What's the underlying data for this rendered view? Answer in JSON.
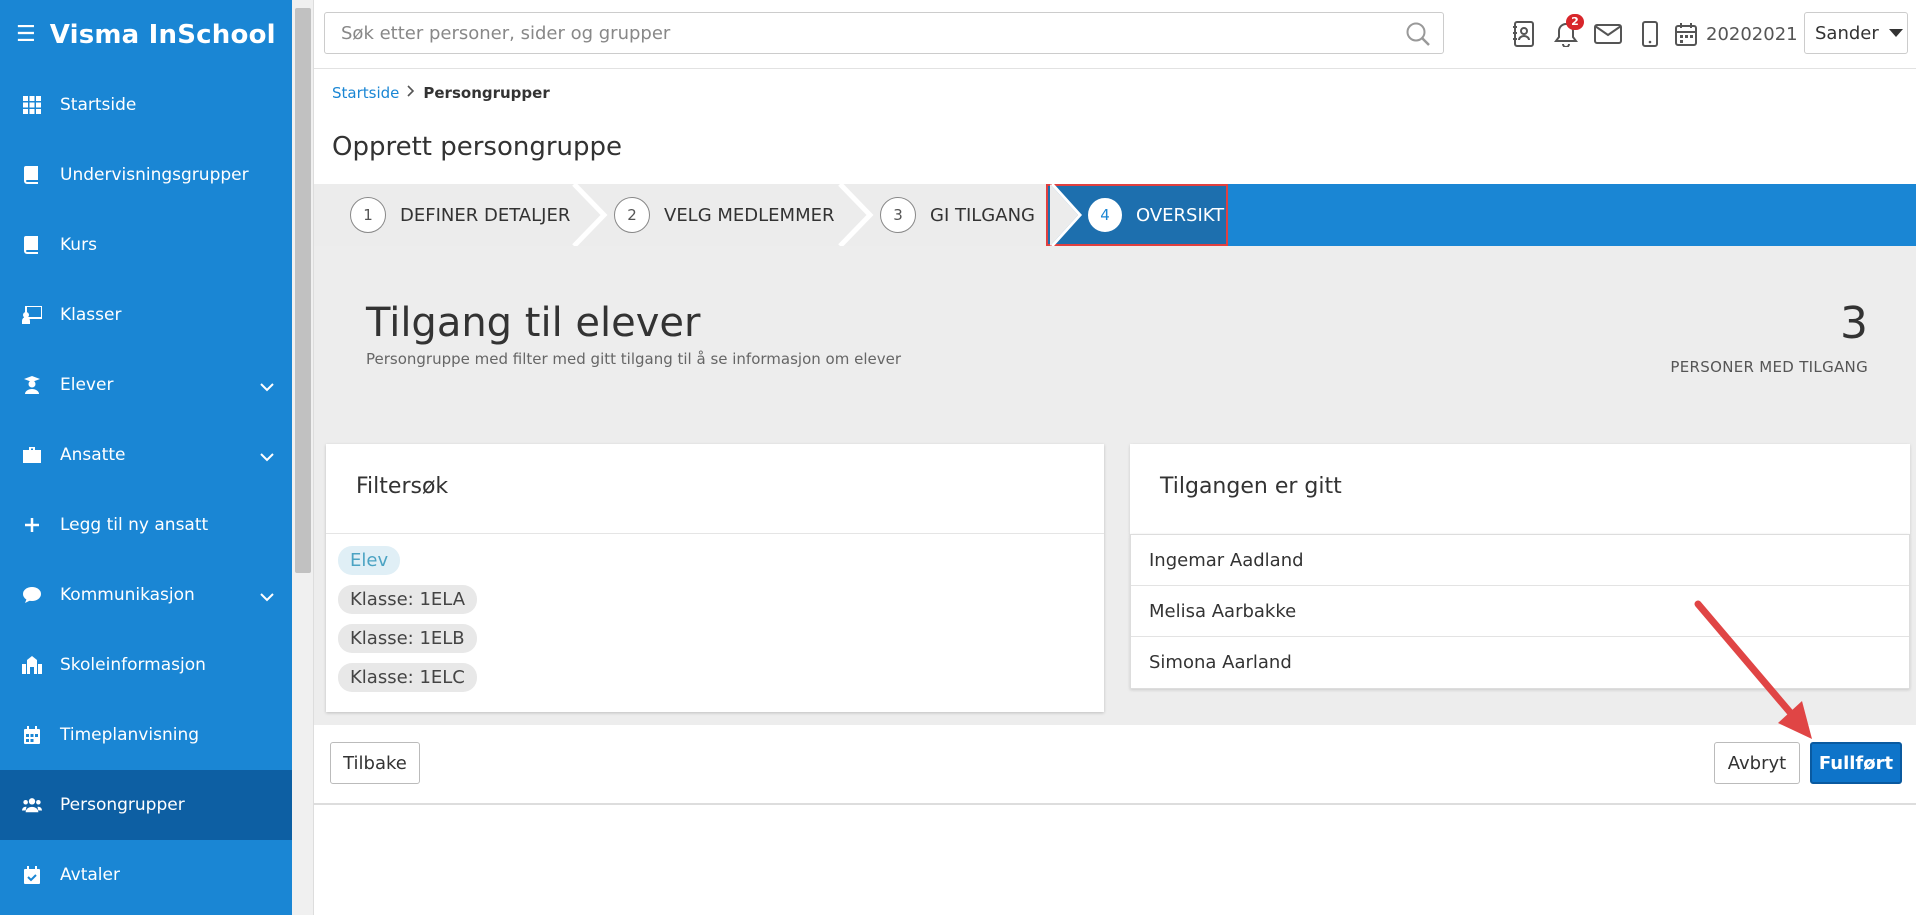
{
  "app": {
    "title": "Visma InSchool"
  },
  "sidebar": {
    "items": [
      {
        "label": "Startside"
      },
      {
        "label": "Undervisningsgrupper"
      },
      {
        "label": "Kurs"
      },
      {
        "label": "Klasser"
      },
      {
        "label": "Elever"
      },
      {
        "label": "Ansatte"
      },
      {
        "label": "Legg til ny ansatt"
      },
      {
        "label": "Kommunikasjon"
      },
      {
        "label": "Skoleinformasjon"
      },
      {
        "label": "Timeplanvisning"
      },
      {
        "label": "Persongrupper"
      },
      {
        "label": "Avtaler"
      }
    ],
    "active_index": 10
  },
  "topbar": {
    "search_placeholder": "Søk etter personer, sider og grupper",
    "notification_count": "2",
    "school_year": "20202021",
    "user": "Sander"
  },
  "breadcrumb": {
    "home": "Startside",
    "current": "Persongrupper"
  },
  "page": {
    "title": "Opprett persongruppe"
  },
  "stepper": {
    "steps": [
      {
        "num": "1",
        "label": "DEFINER DETALJER"
      },
      {
        "num": "2",
        "label": "VELG MEDLEMMER"
      },
      {
        "num": "3",
        "label": "GI TILGANG"
      },
      {
        "num": "4",
        "label": "OVERSIKT"
      }
    ],
    "active_index": 3
  },
  "summary": {
    "heading": "Tilgang til elever",
    "description": "Persongruppe med filter med gitt tilgang til å se informasjon om elever",
    "count": "3",
    "count_label": "PERSONER MED TILGANG"
  },
  "filter_panel": {
    "title": "Filtersøk",
    "tags": [
      "Elev",
      "Klasse: 1ELA",
      "Klasse: 1ELB",
      "Klasse: 1ELC"
    ]
  },
  "access_panel": {
    "title": "Tilgangen er gitt",
    "people": [
      "Ingemar Aadland",
      "Melisa Aarbakke",
      "Simona Aarland"
    ]
  },
  "footer": {
    "back_label": "Tilbake",
    "cancel_label": "Avbryt",
    "done_label": "Fullført"
  },
  "colors": {
    "sidebar": "#1a86d4",
    "sidebar_active": "#0d5fa3",
    "primary_button": "#0e74c9",
    "highlight_red": "#e04040"
  }
}
